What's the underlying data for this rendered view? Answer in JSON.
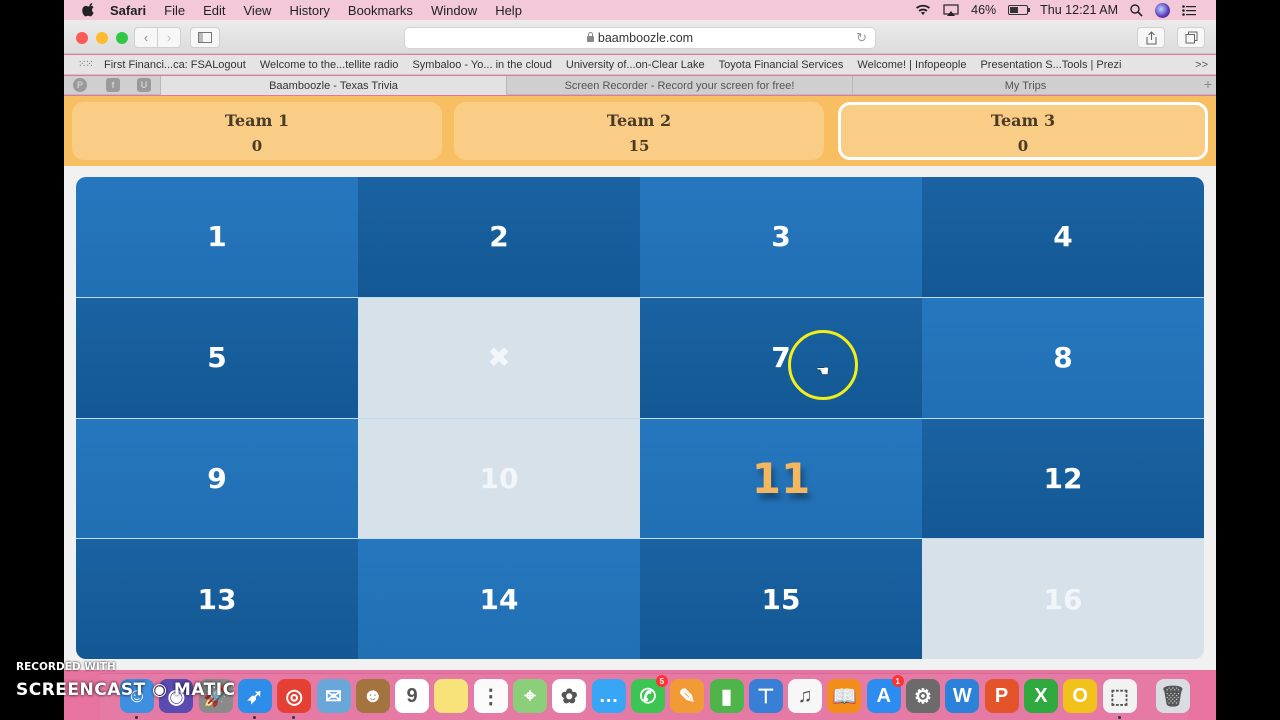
{
  "menubar": {
    "app": "Safari",
    "items": [
      "File",
      "Edit",
      "View",
      "History",
      "Bookmarks",
      "Window",
      "Help"
    ],
    "battery": "46%",
    "clock": "Thu 12:21 AM"
  },
  "toolbar": {
    "url": "baamboozle.com"
  },
  "bookmarks": [
    "First Financi...ca: FSALogout",
    "Welcome to the...tellite radio",
    "Symbaloo - Yo... in the cloud",
    "University of...on-Clear Lake",
    "Toyota Financial Services",
    "Welcome! | Infopeople",
    "Presentation S...Tools | Prezi"
  ],
  "bookmarks_more": ">>",
  "tabs": [
    {
      "label": "Baamboozle - Texas Trivia",
      "active": true
    },
    {
      "label": "Screen Recorder - Record your screen for free!",
      "active": false
    },
    {
      "label": "My Trips",
      "active": false
    }
  ],
  "pinned_tabs": [
    "pinterest",
    "facebook",
    "U"
  ],
  "teams": [
    {
      "name": "Team 1",
      "score": "0",
      "active": false
    },
    {
      "name": "Team 2",
      "score": "15",
      "active": false
    },
    {
      "name": "Team 3",
      "score": "0",
      "active": true
    }
  ],
  "board": {
    "tiles": [
      {
        "label": "1",
        "state": "light"
      },
      {
        "label": "2",
        "state": "dark"
      },
      {
        "label": "3",
        "state": "light"
      },
      {
        "label": "4",
        "state": "dark"
      },
      {
        "label": "5",
        "state": "dark"
      },
      {
        "label": "✖",
        "state": "used"
      },
      {
        "label": "7",
        "state": "dark"
      },
      {
        "label": "8",
        "state": "light"
      },
      {
        "label": "9",
        "state": "light"
      },
      {
        "label": "10",
        "state": "used"
      },
      {
        "label": "11",
        "state": "light highlight"
      },
      {
        "label": "12",
        "state": "dark"
      },
      {
        "label": "13",
        "state": "dark"
      },
      {
        "label": "14",
        "state": "light"
      },
      {
        "label": "15",
        "state": "dark"
      },
      {
        "label": "16",
        "state": "used"
      }
    ]
  },
  "dock": [
    {
      "name": "finder",
      "color": "#3f8fe0",
      "glyph": "☺",
      "running": true
    },
    {
      "name": "siri",
      "color": "#5a4bb0",
      "glyph": "◉",
      "running": false
    },
    {
      "name": "launchpad",
      "color": "#8a8a8a",
      "glyph": "🚀",
      "running": false
    },
    {
      "name": "safari",
      "color": "#2d8de8",
      "glyph": "➶",
      "running": true
    },
    {
      "name": "chrome",
      "color": "#e44134",
      "glyph": "◎",
      "running": true
    },
    {
      "name": "mail",
      "color": "#6aa6d8",
      "glyph": "✉",
      "running": false
    },
    {
      "name": "contacts",
      "color": "#a3743f",
      "glyph": "☻",
      "running": false
    },
    {
      "name": "calendar",
      "color": "#ffffff",
      "glyph": "9",
      "running": false
    },
    {
      "name": "notes",
      "color": "#f8e27a",
      "glyph": "",
      "running": false
    },
    {
      "name": "reminders",
      "color": "#fafafa",
      "glyph": "⋮",
      "running": false
    },
    {
      "name": "maps",
      "color": "#8ccf7a",
      "glyph": "⌖",
      "running": false
    },
    {
      "name": "photos",
      "color": "#ffffff",
      "glyph": "✿",
      "running": false
    },
    {
      "name": "messages",
      "color": "#39a6f5",
      "glyph": "…",
      "running": false
    },
    {
      "name": "facetime",
      "color": "#3cc552",
      "glyph": "✆",
      "badge": "5",
      "running": false
    },
    {
      "name": "pages",
      "color": "#f29a35",
      "glyph": "✎",
      "running": false
    },
    {
      "name": "numbers",
      "color": "#4fb54a",
      "glyph": "▮",
      "running": false
    },
    {
      "name": "keynote",
      "color": "#3a7fd6",
      "glyph": "⊤",
      "running": false
    },
    {
      "name": "itunes",
      "color": "#f7f7f7",
      "glyph": "♫",
      "running": false
    },
    {
      "name": "ibooks",
      "color": "#f28c1a",
      "glyph": "📖",
      "running": false
    },
    {
      "name": "app-store",
      "color": "#2d8cf0",
      "glyph": "A",
      "badge": "1",
      "running": false
    },
    {
      "name": "system-preferences",
      "color": "#6b6b6b",
      "glyph": "⚙",
      "running": false
    },
    {
      "name": "word",
      "color": "#2c82d8",
      "glyph": "W",
      "running": false
    },
    {
      "name": "powerpoint",
      "color": "#e3542b",
      "glyph": "P",
      "running": false
    },
    {
      "name": "excel",
      "color": "#2fa83e",
      "glyph": "X",
      "running": false
    },
    {
      "name": "outlook",
      "color": "#f1c21b",
      "glyph": "O",
      "running": false
    },
    {
      "name": "screenshot",
      "color": "#f2f2f2",
      "glyph": "⬚",
      "running": true
    },
    {
      "name": "trash",
      "color": "#d9dde2",
      "glyph": "🗑",
      "running": false
    }
  ],
  "watermark": {
    "line1": "RECORDED WITH",
    "line2": "SCREENCAST ◉ MATIC"
  }
}
